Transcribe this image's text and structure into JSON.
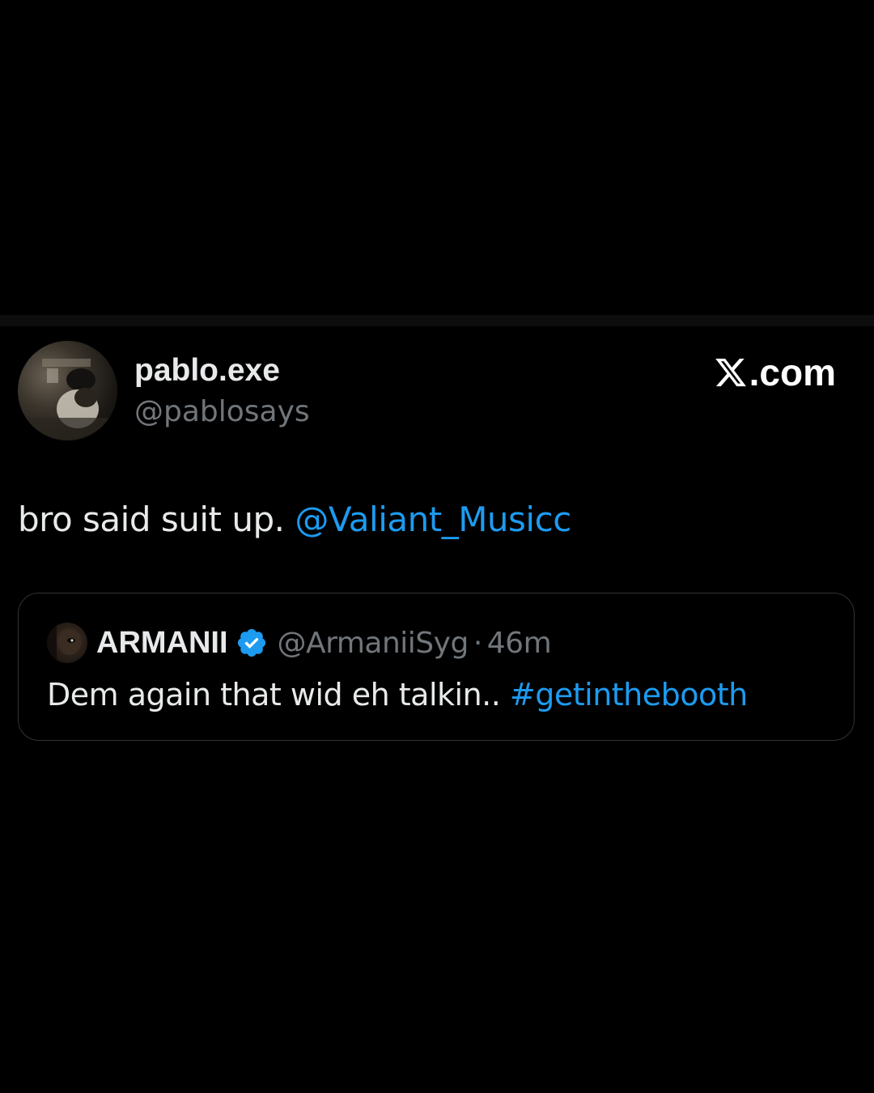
{
  "author": {
    "display_name": "pablo.exe",
    "handle": "@pablosays",
    "avatar_icon": "user-avatar-photo"
  },
  "brand": {
    "label": ".com",
    "icon": "x-logo-icon",
    "color": "#ffffff"
  },
  "tweet": {
    "text": "bro said suit up. ",
    "mention": "@Valiant_Musicc"
  },
  "quoted": {
    "display_name": "ARMANII",
    "verified_icon": "verified-badge-icon",
    "handle": "@ArmaniiSyg",
    "separator": "·",
    "time": "46m",
    "text": "Dem again that wid eh talkin.. ",
    "hashtag": "#getinthebooth"
  },
  "colors": {
    "background": "#000000",
    "text_primary": "#e7e9ea",
    "text_secondary": "#71767b",
    "accent": "#1d9bf0",
    "border": "#2f3336"
  }
}
